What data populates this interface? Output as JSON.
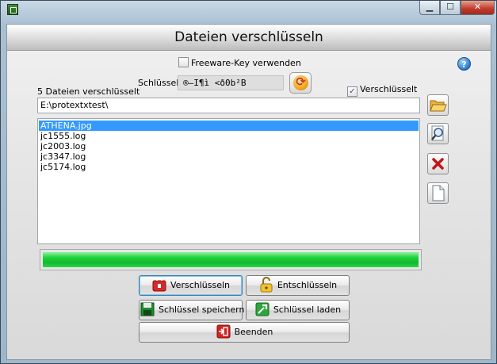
{
  "window": {
    "title": ""
  },
  "header": {
    "title": "Dateien verschlüsseln"
  },
  "freeware": {
    "label": "Freeware-Key verwenden",
    "checked": false
  },
  "key": {
    "label": "Schlüssel:",
    "value": "®–I¶ì  <ð0b²B"
  },
  "encrypted": {
    "label": "Verschlüsselt",
    "checked": true
  },
  "status": {
    "text": "5 Dateien verschlüsselt"
  },
  "path": {
    "value": "E:\\protextxtest\\"
  },
  "files": {
    "items": [
      {
        "name": "ATHENA.jpg",
        "selected": true
      },
      {
        "name": "jc1555.log",
        "selected": false
      },
      {
        "name": "jc2003.log",
        "selected": false
      },
      {
        "name": "jc3347.log",
        "selected": false
      },
      {
        "name": "jc5174.log",
        "selected": false
      }
    ]
  },
  "progress": {
    "value": 1.0,
    "color": "#1fd43a"
  },
  "buttons": {
    "encrypt": "Verschlüsseln",
    "decrypt": "Entschlüsseln",
    "save_key": "Schlüssel speichern",
    "load_key": "Schlüssel laden",
    "exit": "Beenden"
  },
  "icons": {
    "help": "?",
    "folder": "folder-open-icon",
    "search": "magnifier-icon",
    "delete": "red-x-icon",
    "new": "blank-document-icon"
  },
  "colors": {
    "accent": "#3399ff",
    "progress": "#1fd43a",
    "danger": "#c0392b"
  }
}
